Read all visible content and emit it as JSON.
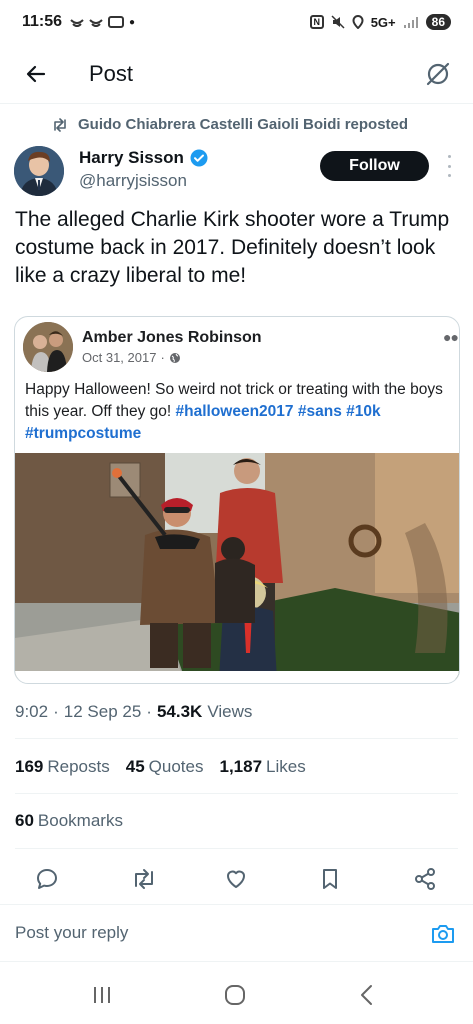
{
  "status_bar": {
    "time": "11:56",
    "network": "5G+",
    "battery": "86"
  },
  "header": {
    "title": "Post",
    "back_icon": "arrow-left-icon",
    "grok_icon": "grok-icon"
  },
  "repost": {
    "text": "Guido Chiabrera Castelli Gaioli Boidi reposted"
  },
  "author": {
    "name": "Harry Sisson",
    "handle": "@harryjsisson",
    "verified": true,
    "follow_label": "Follow"
  },
  "post": {
    "text": "The alleged Charlie Kirk shooter wore a Trump costume back in 2017. Definitely doesn’t look like a crazy liberal to me!"
  },
  "embedded": {
    "name": "Amber Jones Robinson",
    "date": "Oct 31, 2017",
    "separator": "·",
    "body_text": "Happy Halloween! So weird not trick or treating with the boys this year. Off they go!",
    "hashtags": [
      "#halloween2017",
      "#sans",
      "#10k",
      "#trumpcostume"
    ]
  },
  "meta": {
    "time": "9:02",
    "sep1": "·",
    "date": "12 Sep 25",
    "sep2": "·",
    "views_count": "54.3K",
    "views_label": "Views"
  },
  "stats": {
    "reposts_count": "169",
    "reposts_label": "Reposts",
    "quotes_count": "45",
    "quotes_label": "Quotes",
    "likes_count": "1,187",
    "likes_label": "Likes",
    "bookmarks_count": "60",
    "bookmarks_label": "Bookmarks"
  },
  "reply": {
    "placeholder": "Post your reply"
  },
  "colors": {
    "accent": "#1d9bf0",
    "text_primary": "#0f1419",
    "text_secondary": "#536471",
    "hashtag": "#1f6fd0"
  }
}
